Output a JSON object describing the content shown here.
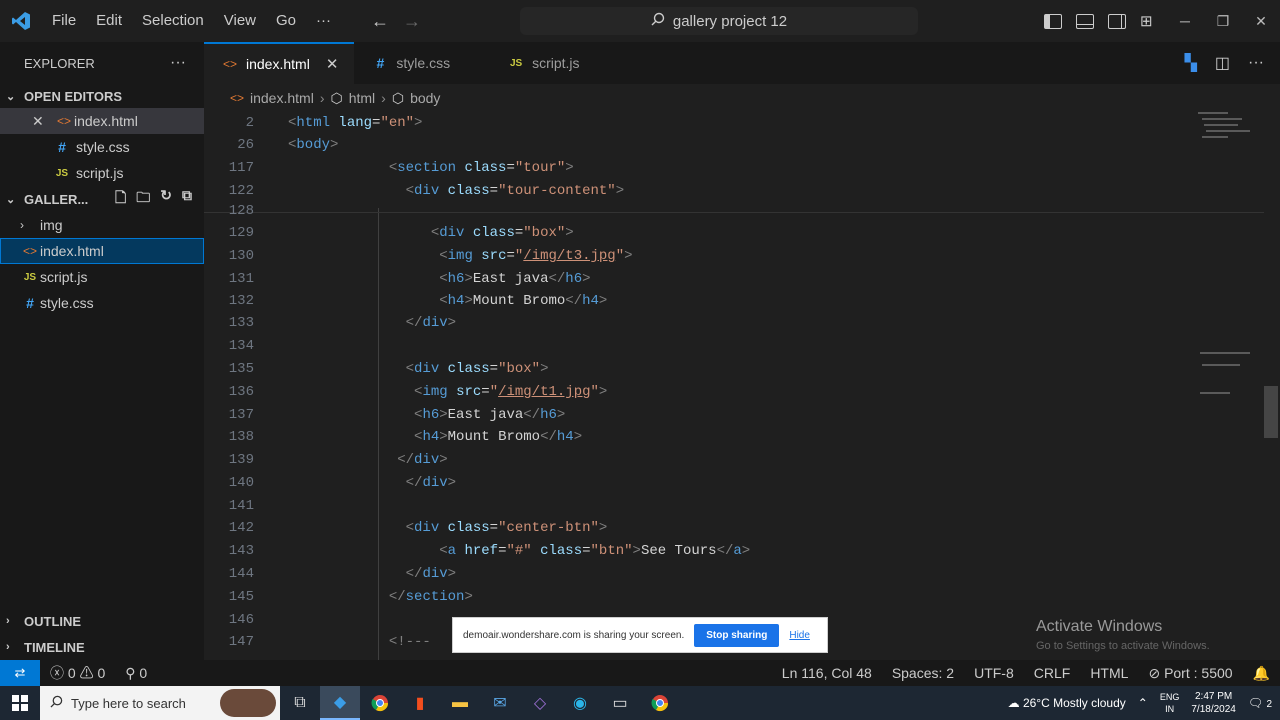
{
  "menu": [
    "File",
    "Edit",
    "Selection",
    "View",
    "Go",
    "···"
  ],
  "command_center": "gallery project 12",
  "sidebar": {
    "title": "EXPLORER",
    "open_editors_label": "OPEN EDITORS",
    "open_editors": [
      "index.html",
      "style.css",
      "script.js"
    ],
    "folder_label": "GALLER...",
    "tree": [
      "img",
      "index.html",
      "script.js",
      "style.css"
    ],
    "outline": "OUTLINE",
    "timeline": "TIMELINE"
  },
  "tabs": [
    "index.html",
    "style.css",
    "script.js"
  ],
  "breadcrumb": [
    "index.html",
    "html",
    "body"
  ],
  "code": {
    "ln": [
      "2",
      "26",
      "117",
      "122",
      "128",
      "129",
      "130",
      "131",
      "132",
      "133",
      "134",
      "135",
      "136",
      "137",
      "138",
      "139",
      "140",
      "141",
      "142",
      "143",
      "144",
      "145",
      "146",
      "147"
    ],
    "tag_html": "html",
    "attr_lang": "lang",
    "val_en": "\"en\"",
    "tag_body": "body",
    "tag_section": "section",
    "attr_class": "class",
    "val_tour": "\"tour\"",
    "tag_div": "div",
    "val_tour_content": "\"tour-content\"",
    "val_box": "\"box\"",
    "tag_img": "img",
    "attr_src": "src",
    "val_t3": "/img/t3.jpg",
    "val_t1": "/img/t1.jpg",
    "tag_h6": "h6",
    "text_east_java": "East java",
    "tag_h4": "h4",
    "text_mount_bromo": "Mount Bromo",
    "val_center_btn": "\"center-btn\"",
    "tag_a": "a",
    "attr_href": "href",
    "val_hash": "\"#\"",
    "val_btn": "\"btn\"",
    "text_see_tours": "See Tours",
    "comment_start": "<!---"
  },
  "watermark": {
    "title": "Activate Windows",
    "subtitle": "Go to Settings to activate Windows."
  },
  "share_bar": {
    "message": "demoair.wondershare.com is sharing your screen.",
    "stop": "Stop sharing",
    "hide": "Hide"
  },
  "status": {
    "errors": "0",
    "warnings": "0",
    "ports": "0",
    "position": "Ln 116, Col 48",
    "spaces": "Spaces: 2",
    "encoding": "UTF-8",
    "eol": "CRLF",
    "language": "HTML",
    "port": "Port : 5500"
  },
  "taskbar": {
    "search_placeholder": "Type here to search",
    "weather": "26°C  Mostly cloudy",
    "lang_1": "ENG",
    "lang_2": "IN",
    "time": "2:47 PM",
    "date": "7/18/2024",
    "notifications": "2"
  },
  "colors": {
    "accent": "#0078d4",
    "editor_bg": "#1f1f1f",
    "sidebar_bg": "#181818"
  }
}
